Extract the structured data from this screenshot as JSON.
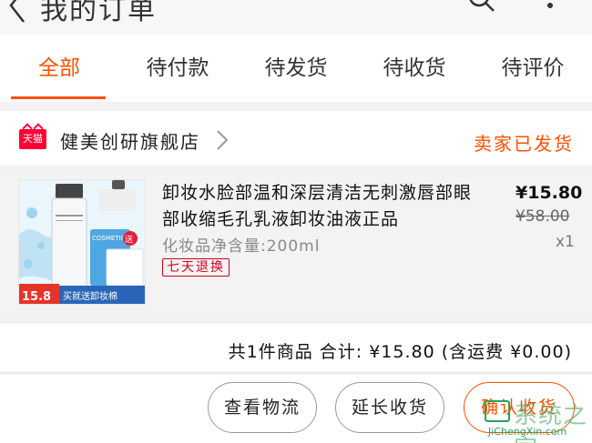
{
  "header": {
    "title": "我的订单",
    "back_icon": "back-arrow-icon",
    "search_icon": "search-icon",
    "more_icon": "more-vertical-icon"
  },
  "tabs": [
    {
      "label": "全部",
      "active": true
    },
    {
      "label": "待付款",
      "active": false
    },
    {
      "label": "待发货",
      "active": false
    },
    {
      "label": "待收货",
      "active": false
    },
    {
      "label": "待评价",
      "active": false
    }
  ],
  "order": {
    "store_badge": "天猫",
    "store_name": "健美创研旗舰店",
    "status": "卖家已发货",
    "item": {
      "title": "卸妆水脸部温和深层清洁无刺激唇部眼部收缩毛孔乳液卸妆油液正品",
      "spec": "化妆品净含量:200ml",
      "tag": "七天退换",
      "price": "¥15.80",
      "original_price": "¥58.00",
      "quantity": "x1",
      "thumb": {
        "brand_text": "COSMETIC COTTON",
        "gift_badge": "送",
        "price_badge": "15.8",
        "promo_text": "买就送卸妆棉"
      }
    },
    "summary": "共1件商品 合计: ¥15.80 (含运费 ¥0.00)",
    "buttons": {
      "logistics": "查看物流",
      "extend": "延长收货",
      "confirm": "确认收货"
    }
  },
  "watermark": {
    "text": "系统之家",
    "url": "JiChengXin.com"
  },
  "colors": {
    "accent": "#ff5000",
    "tmall_red": "#ff0036",
    "tag_red": "#d0021b"
  }
}
